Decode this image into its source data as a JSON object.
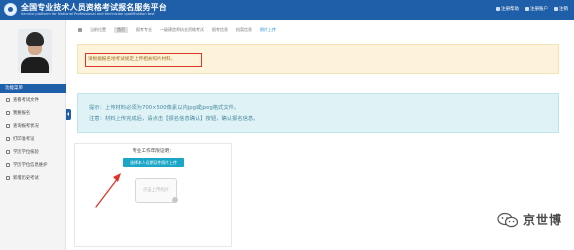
{
  "header": {
    "title": "全国专业技术人员资格考试报名服务平台",
    "subtitle": "Service platform for National Professional and technician qualification test",
    "nav": [
      "注册帮助",
      "注册账户",
      "注销"
    ]
  },
  "sidebar": {
    "menu_title": "功能菜单",
    "items": [
      {
        "label": "查看考试文件"
      },
      {
        "label": "我要报名"
      },
      {
        "label": "查询报考状况"
      },
      {
        "label": "打印准考证"
      },
      {
        "label": "学历学位核验"
      },
      {
        "label": "学历学位信息维护"
      },
      {
        "label": "新增历史考试"
      }
    ]
  },
  "breadcrumb": {
    "items": [
      "当前位置",
      "首页",
      "报考专业",
      "一级建造师执业资格考试",
      "报考信息",
      "档案信息"
    ],
    "active": "照片上传"
  },
  "warning": {
    "text": "请根据报名地考试规定上传相关照片材料。"
  },
  "tip": {
    "line1": "提示：上传材料必须为700×500像素以内jpg或jpeg格式文件。",
    "line2": "注意：材料上传完成后，请点击【报名信息确认】按钮，确认报名信息。"
  },
  "upload": {
    "label": "专业工作年限证明：",
    "button": "选择本人近期证件照片上传",
    "preview": "点击上传照片"
  },
  "watermark": {
    "text": "京世博"
  },
  "colors": {
    "header_blue": "#1f5ea8",
    "warning_bg": "#fcf3da",
    "warning_border": "#e0342a",
    "tip_bg": "#dff3f6",
    "button_cyan": "#1ba6c6",
    "arrow_red": "#e0342a"
  }
}
